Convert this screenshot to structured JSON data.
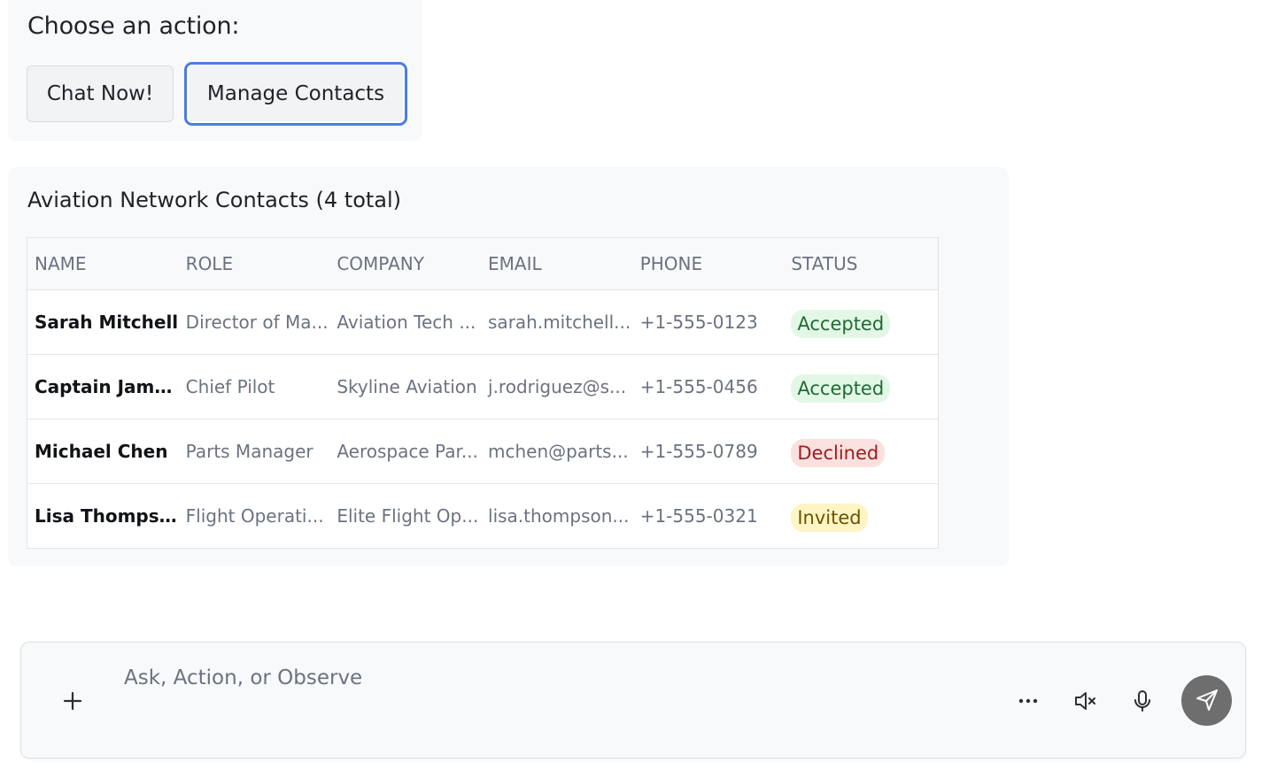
{
  "action_panel": {
    "title": "Choose an action:",
    "buttons": [
      {
        "label": "Chat Now!"
      },
      {
        "label": "Manage Contacts"
      }
    ]
  },
  "contacts": {
    "title": "Aviation Network Contacts (4 total)",
    "columns": [
      "NAME",
      "ROLE",
      "COMPANY",
      "EMAIL",
      "PHONE",
      "STATUS"
    ],
    "rows": [
      {
        "name": "Sarah Mitchell",
        "role": "Director of Ma...",
        "company": "Aviation Tech ...",
        "email": "sarah.mitchell...",
        "phone": "+1-555-0123",
        "status": "Accepted"
      },
      {
        "name": "Captain Jame...",
        "role": "Chief Pilot",
        "company": "Skyline Aviation",
        "email": "j.rodriguez@s...",
        "phone": "+1-555-0456",
        "status": "Accepted"
      },
      {
        "name": "Michael Chen",
        "role": "Parts Manager",
        "company": "Aerospace Par...",
        "email": "mchen@parts...",
        "phone": "+1-555-0789",
        "status": "Declined"
      },
      {
        "name": "Lisa Thompson",
        "role": "Flight Operati...",
        "company": "Elite Flight Op...",
        "email": "lisa.thompson...",
        "phone": "+1-555-0321",
        "status": "Invited"
      }
    ],
    "status_colors": {
      "Accepted": "#1f6b34",
      "Declined": "#9a1d1d",
      "Invited": "#6d5300"
    }
  },
  "composer": {
    "placeholder": "Ask, Action, or Observe",
    "value": "",
    "icons": [
      "plus-icon",
      "more-horizontal-icon",
      "volume-mute-icon",
      "microphone-icon",
      "send-icon"
    ],
    "send_button_color": "#6e6e6e"
  }
}
